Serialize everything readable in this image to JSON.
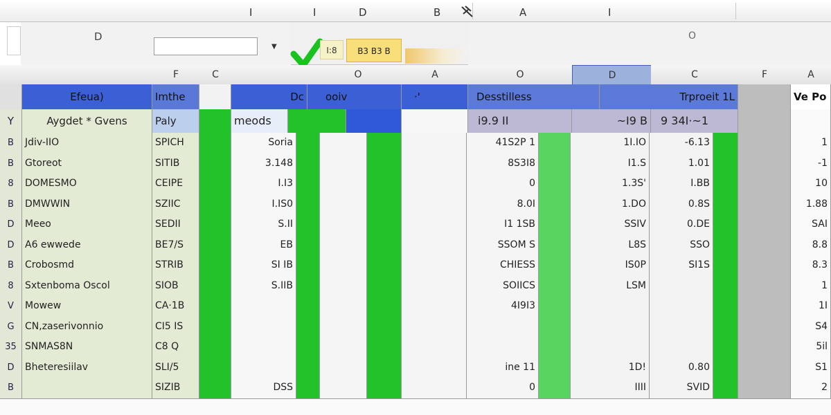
{
  "ruler": {
    "marks": [
      "I",
      "I",
      "D",
      "B",
      "A",
      "I"
    ]
  },
  "toolbar": {
    "name_box_label": "D",
    "formula_value": "",
    "button1_label": "I:8",
    "button2_label": "B3 B3 B",
    "right_label": "O"
  },
  "column_headers": [
    "F",
    "C",
    "O",
    "A",
    "O",
    "D",
    "C",
    "F",
    "A"
  ],
  "header_row": {
    "c1": "Efeua)",
    "c2": "Imthe",
    "c3": "Dc",
    "c3b": "ooiv",
    "c4": "·'",
    "c5": "Desstilless",
    "c6": "Trproeit 1L",
    "far": "Ve Po"
  },
  "sub_row": {
    "rownum": "Y",
    "name": "Aygdet * Gvens",
    "code": "Paly",
    "v1": "meods",
    "v2": "i9.9 II",
    "v3": "~I9 B",
    "v4": "9 34I·~1"
  },
  "rows": [
    {
      "rownum": "B",
      "name": "Jdiv-IIO",
      "code": "SPICH",
      "v1": "Soria",
      "v2": "41S2P  1",
      "v3": "1I.IO",
      "v4": "-6.13",
      "far": "1"
    },
    {
      "rownum": "B",
      "name": "Gtoreot",
      "code": "SITIB",
      "v1": "3.148",
      "v2": "8S3I8",
      "v3": "I1.S",
      "v4": "1.01",
      "far": "-1"
    },
    {
      "rownum": "8",
      "name": "DOMESMO",
      "code": "CEIPE",
      "v1": "I.I3",
      "v2": "0",
      "v3": "1.3S'",
      "v4": "I.BB",
      "far": "10"
    },
    {
      "rownum": "B",
      "name": "DMWWIN",
      "code": "SZIIC",
      "v1": "I.IS0",
      "v2": "8.0I",
      "v3": "1.DO",
      "v4": "0.8S",
      "far": "1.88"
    },
    {
      "rownum": "D",
      "name": "Meeo",
      "code": "SEDII",
      "v1": "S.II",
      "v2": "I1 1SB",
      "v3": "SSIV",
      "v4": "0.DE",
      "far": "SAI"
    },
    {
      "rownum": "D",
      "name": "A6 ewwede",
      "code": "BE7/S",
      "v1": "EB",
      "v2": "SSOM S",
      "v3": "L8S",
      "v4": "SSO",
      "far": "8.8"
    },
    {
      "rownum": "B",
      "name": "Crobosmd",
      "code": "STRIB",
      "v1": "SI IB",
      "v2": "CHIESS",
      "v3": "IS0P",
      "v4": "SI1S",
      "far": "8.3"
    },
    {
      "rownum": "8",
      "name": "Sxtenboma Oscol",
      "code": "SIOB",
      "v1": "S.IIB",
      "v2": "SOIICS",
      "v3": "LSM",
      "v4": "",
      "far": "1"
    },
    {
      "rownum": "V",
      "name": "Mowew",
      "code": "CA·1B",
      "v1": "",
      "v2": "4I9I3",
      "v3": "",
      "v4": "",
      "far": "1I"
    },
    {
      "rownum": "G",
      "name": "CN,zaserivonnio",
      "code": "CI5 IS",
      "v1": "",
      "v2": "",
      "v3": "",
      "v4": "",
      "far": "S4"
    },
    {
      "rownum": "35",
      "name": "SNMAS8N",
      "code": "C8 Q",
      "v1": "",
      "v2": "",
      "v3": "",
      "v4": "",
      "far": "5il"
    },
    {
      "rownum": "D",
      "name": "Bheteresiilav",
      "code": "SLI/5",
      "v1": "",
      "v2": "ine  11",
      "v3": "1D!",
      "v4": "0.80",
      "far": "S1"
    },
    {
      "rownum": "B",
      "name": "",
      "code": "SIZIB",
      "v1": "DSS",
      "v2": "0",
      "v3": "IIII",
      "v4": "SVID",
      "far": "2"
    }
  ]
}
